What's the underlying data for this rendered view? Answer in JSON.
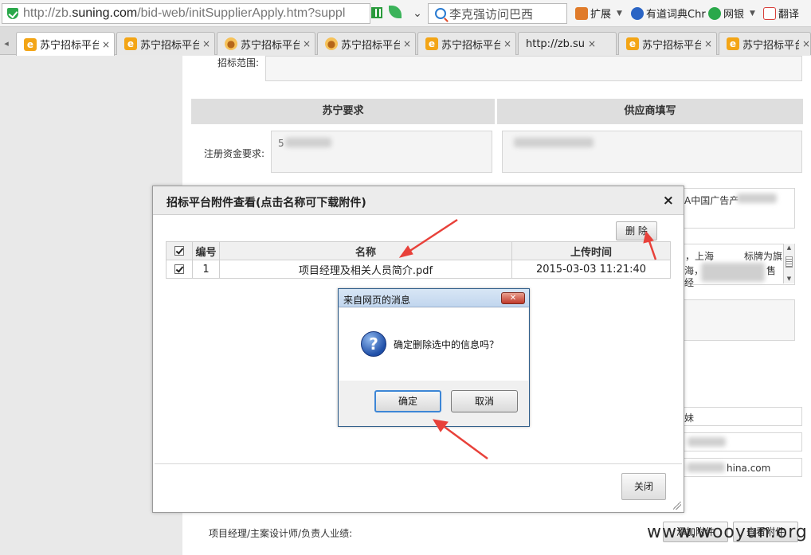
{
  "browser": {
    "url_prefix": "http://zb.",
    "url_host": "suning.com",
    "url_path": "/bid-web/initSupplierApply.htm?suppl",
    "search_text": "李克强访问巴西",
    "toolbar_items": [
      {
        "label": "扩展",
        "icon": "extension-icon",
        "color": "#e07b2a"
      },
      {
        "label": "有道词典Chr",
        "icon": "youdao-icon",
        "color": "#2a64c4"
      },
      {
        "label": "网银",
        "icon": "ebank-icon",
        "color": "#2aa84a"
      },
      {
        "label": "翻译",
        "icon": "translate-icon",
        "color": "#d8403a"
      }
    ],
    "tabs": [
      {
        "title": "苏宁招标平台",
        "favicon": "ie"
      },
      {
        "title": "苏宁招标平台",
        "favicon": "ie"
      },
      {
        "title": "苏宁招标平台",
        "favicon": "bear"
      },
      {
        "title": "苏宁招标平台",
        "favicon": "bear"
      },
      {
        "title": "苏宁招标平台",
        "favicon": "ie"
      },
      {
        "title": "http://zb.sun",
        "favicon": "page"
      },
      {
        "title": "苏宁招标平台",
        "favicon": "ie"
      },
      {
        "title": "苏宁招标平台",
        "favicon": "ie"
      }
    ],
    "tab_close": "×"
  },
  "form": {
    "scope_label": "招标范围:",
    "col_suning": "苏宁要求",
    "col_supplier": "供应商填写",
    "capital_label": "注册资金要求:",
    "capital_value_start": "5",
    "supplier_value_start": "",
    "peek_ad": "A中国广告产",
    "peek_brand": "，上海",
    "peek_brand2": "标牌为旗",
    "peek_brand3": "海，",
    "peek_brand4": "售",
    "peek_brand5": "经",
    "peek_li": "妹",
    "peek_mail": "hina.com",
    "perf_label": "项目经理/主案设计师/负责人业绩:",
    "bottom_btn1": "添加附件",
    "bottom_btn2": "查看附件"
  },
  "modal": {
    "title": "招标平台附件查看(点击名称可下载附件)",
    "close": "×",
    "delete_btn": "删 除",
    "columns": [
      "编号",
      "名称",
      "上传时间"
    ],
    "rows": [
      {
        "no": "1",
        "name": "项目经理及相关人员简介.pdf",
        "time": "2015-03-03 11:21:40"
      }
    ],
    "close_btn": "关闭"
  },
  "alert": {
    "title": "来自网页的消息",
    "message": "确定删除选中的信息吗？",
    "ok": "确定",
    "cancel": "取消",
    "icon": "question-icon"
  },
  "watermark": "www.wooyun.org",
  "colors": {
    "arrow": "#e8413a",
    "accent_blue": "#3d86d6"
  }
}
